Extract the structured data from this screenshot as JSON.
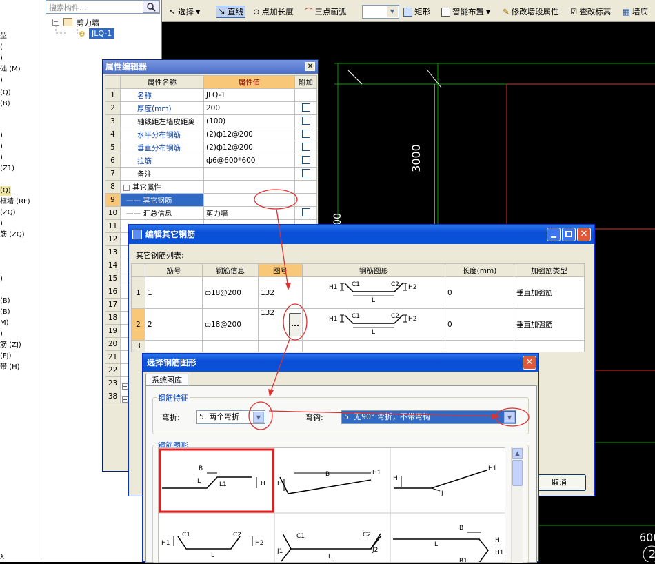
{
  "left_tree": {
    "items": [
      "型",
      "(",
      ")",
      "础 (M)",
      ")",
      "(Q)",
      "(B)",
      ")",
      ")",
      ")",
      "(Z1)",
      "(Q)",
      "框墙 (RF)",
      "(ZQ)",
      ")",
      "筋 (ZQ)",
      ")",
      "(B)",
      "(B)",
      "M)",
      ")",
      "筋 (ZJ)",
      "(FJ)",
      "带 (H)",
      "λ"
    ]
  },
  "component_panel": {
    "search_placeholder": "搜索构件...",
    "root": "剪力墙",
    "child": "JLQ-1"
  },
  "toolbar": {
    "select": "选择",
    "line": "直线",
    "point_length": "点加长度",
    "three_point_arc": "三点画弧",
    "rect": "矩形",
    "smart_layout": "智能布置",
    "modify_wall": "修改墙段属性",
    "check_elevation": "查改标高",
    "wall_more": "墙底"
  },
  "canvas": {
    "dim1": "3000",
    "dim2": "00",
    "dim3": "600",
    "dim4": "2"
  },
  "prop_editor": {
    "title": "属性编辑器",
    "headers": [
      "属性名称",
      "属性值",
      "附加"
    ],
    "rows": [
      {
        "n": "1",
        "name": "名称",
        "value": "JLQ-1"
      },
      {
        "n": "2",
        "name": "厚度(mm)",
        "value": "200"
      },
      {
        "n": "3",
        "name": "轴线距左墙皮距离",
        "value": "(100)"
      },
      {
        "n": "4",
        "name": "水平分布钢筋",
        "value": "(2)ф12@200"
      },
      {
        "n": "5",
        "name": "垂直分布钢筋",
        "value": "(2)ф12@200"
      },
      {
        "n": "6",
        "name": "拉筋",
        "value": "ф6@600*600"
      },
      {
        "n": "7",
        "name": "备注",
        "value": ""
      },
      {
        "n": "8",
        "name": "其它属性",
        "value": ""
      },
      {
        "n": "9",
        "name": "其它钢筋",
        "value": ""
      },
      {
        "n": "10",
        "name": "汇总信息",
        "value": "剪力墙"
      },
      {
        "n": "11",
        "name": "",
        "value": ""
      },
      {
        "n": "12",
        "name": "",
        "value": ""
      },
      {
        "n": "13",
        "name": "",
        "value": ""
      },
      {
        "n": "14",
        "name": "",
        "value": ""
      },
      {
        "n": "15",
        "name": "",
        "value": ""
      },
      {
        "n": "16",
        "name": "",
        "value": ""
      },
      {
        "n": "17",
        "name": "",
        "value": ""
      },
      {
        "n": "18",
        "name": "",
        "value": ""
      },
      {
        "n": "19",
        "name": "",
        "value": ""
      },
      {
        "n": "20",
        "name": "",
        "value": ""
      },
      {
        "n": "21",
        "name": "",
        "value": ""
      },
      {
        "n": "22",
        "name": "",
        "value": ""
      },
      {
        "n": "23",
        "name": "",
        "value": ""
      },
      {
        "n": "38",
        "name": "",
        "value": ""
      }
    ]
  },
  "edit_other": {
    "title": "编辑其它钢筋",
    "list_label": "其它钢筋列表:",
    "headers": [
      "筋号",
      "钢筋信息",
      "图号",
      "钢筋图形",
      "长度(mm)",
      "加强筋类型"
    ],
    "rows": [
      {
        "n": "1",
        "bar": "1",
        "info": "ф18@200",
        "fig": "132",
        "length": "0",
        "type": "垂直加强筋"
      },
      {
        "n": "2",
        "bar": "2",
        "info": "ф18@200",
        "fig": "132",
        "length": "0",
        "type": "垂直加强筋"
      },
      {
        "n": "3",
        "bar": "",
        "info": "",
        "fig": "",
        "length": "",
        "type": ""
      }
    ],
    "ellipsis": "...",
    "cancel": "取消",
    "shape_labels": {
      "h1": "H1",
      "c1": "C1",
      "c2": "C2",
      "h2": "H2",
      "l": "L"
    }
  },
  "select_shape": {
    "title": "选择钢筋图形",
    "tab": "系统图库",
    "feature_group": "钢筋特征",
    "bend_label": "弯折:",
    "bend_value": "5. 两个弯折",
    "hook_label": "弯钩:",
    "hook_value": "5. 无90° 弯折，不带弯钩",
    "shape_group": "钢筋图形",
    "labels": {
      "b": "B",
      "l": "L",
      "l1": "L1",
      "h": "H",
      "h1": "H1",
      "j": "J",
      "j1": "J1",
      "j2": "J2",
      "c1": "C1",
      "c2": "C2",
      "h2": "H2",
      "b1": "B1"
    }
  },
  "colors": {
    "accent": "#316ac5",
    "red": "#e03030",
    "green": "#00a000"
  }
}
